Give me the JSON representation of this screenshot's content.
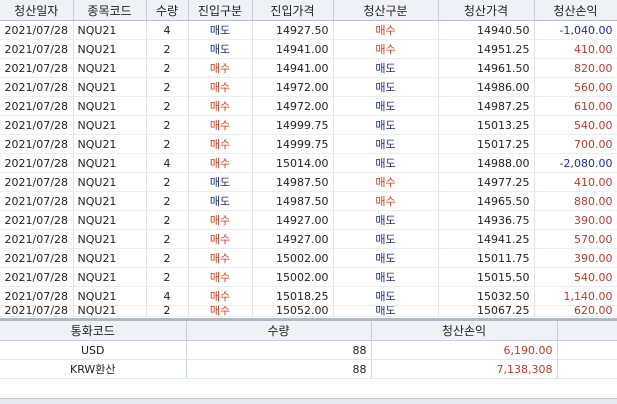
{
  "grid": {
    "headers": [
      "청산일자",
      "종목코드",
      "수량",
      "진입구분",
      "진입가격",
      "청산구분",
      "청산가격",
      "청산손익"
    ],
    "rows": [
      {
        "date": "2021/07/28",
        "code": "NQU21",
        "qty": "4",
        "entry_type": "매도",
        "entry_price": "14927.50",
        "exit_type": "매수",
        "exit_price": "14940.50",
        "pnl": "-1,040.00"
      },
      {
        "date": "2021/07/28",
        "code": "NQU21",
        "qty": "2",
        "entry_type": "매도",
        "entry_price": "14941.00",
        "exit_type": "매수",
        "exit_price": "14951.25",
        "pnl": "410.00"
      },
      {
        "date": "2021/07/28",
        "code": "NQU21",
        "qty": "2",
        "entry_type": "매수",
        "entry_price": "14941.00",
        "exit_type": "매도",
        "exit_price": "14961.50",
        "pnl": "820.00"
      },
      {
        "date": "2021/07/28",
        "code": "NQU21",
        "qty": "2",
        "entry_type": "매수",
        "entry_price": "14972.00",
        "exit_type": "매도",
        "exit_price": "14986.00",
        "pnl": "560.00"
      },
      {
        "date": "2021/07/28",
        "code": "NQU21",
        "qty": "2",
        "entry_type": "매수",
        "entry_price": "14972.00",
        "exit_type": "매도",
        "exit_price": "14987.25",
        "pnl": "610.00"
      },
      {
        "date": "2021/07/28",
        "code": "NQU21",
        "qty": "2",
        "entry_type": "매수",
        "entry_price": "14999.75",
        "exit_type": "매도",
        "exit_price": "15013.25",
        "pnl": "540.00"
      },
      {
        "date": "2021/07/28",
        "code": "NQU21",
        "qty": "2",
        "entry_type": "매수",
        "entry_price": "14999.75",
        "exit_type": "매도",
        "exit_price": "15017.25",
        "pnl": "700.00"
      },
      {
        "date": "2021/07/28",
        "code": "NQU21",
        "qty": "4",
        "entry_type": "매수",
        "entry_price": "15014.00",
        "exit_type": "매도",
        "exit_price": "14988.00",
        "pnl": "-2,080.00"
      },
      {
        "date": "2021/07/28",
        "code": "NQU21",
        "qty": "2",
        "entry_type": "매도",
        "entry_price": "14987.50",
        "exit_type": "매수",
        "exit_price": "14977.25",
        "pnl": "410.00"
      },
      {
        "date": "2021/07/28",
        "code": "NQU21",
        "qty": "2",
        "entry_type": "매도",
        "entry_price": "14987.50",
        "exit_type": "매수",
        "exit_price": "14965.50",
        "pnl": "880.00"
      },
      {
        "date": "2021/07/28",
        "code": "NQU21",
        "qty": "2",
        "entry_type": "매수",
        "entry_price": "14927.00",
        "exit_type": "매도",
        "exit_price": "14936.75",
        "pnl": "390.00"
      },
      {
        "date": "2021/07/28",
        "code": "NQU21",
        "qty": "2",
        "entry_type": "매수",
        "entry_price": "14927.00",
        "exit_type": "매도",
        "exit_price": "14941.25",
        "pnl": "570.00"
      },
      {
        "date": "2021/07/28",
        "code": "NQU21",
        "qty": "2",
        "entry_type": "매수",
        "entry_price": "15002.00",
        "exit_type": "매도",
        "exit_price": "15011.75",
        "pnl": "390.00"
      },
      {
        "date": "2021/07/28",
        "code": "NQU21",
        "qty": "2",
        "entry_type": "매수",
        "entry_price": "15002.00",
        "exit_type": "매도",
        "exit_price": "15015.50",
        "pnl": "540.00"
      },
      {
        "date": "2021/07/28",
        "code": "NQU21",
        "qty": "4",
        "entry_type": "매수",
        "entry_price": "15018.25",
        "exit_type": "매도",
        "exit_price": "15032.50",
        "pnl": "1,140.00"
      },
      {
        "date": "2021/07/28",
        "code": "NQU21",
        "qty": "2",
        "entry_type": "매수",
        "entry_price": "15052.00",
        "exit_type": "매도",
        "exit_price": "15067.25",
        "pnl": "620.00"
      }
    ]
  },
  "summary": {
    "headers": [
      "통화코드",
      "수량",
      "청산손익"
    ],
    "rows": [
      {
        "currency": "USD",
        "qty": "88",
        "pnl": "6,190.00"
      },
      {
        "currency": "KRW환산",
        "qty": "88",
        "pnl": "7,138,308"
      }
    ]
  },
  "colors": {
    "buy": "#d83a1a",
    "sell": "#1c2f80",
    "profit": "#c0392b",
    "loss": "#1b2e9a"
  }
}
